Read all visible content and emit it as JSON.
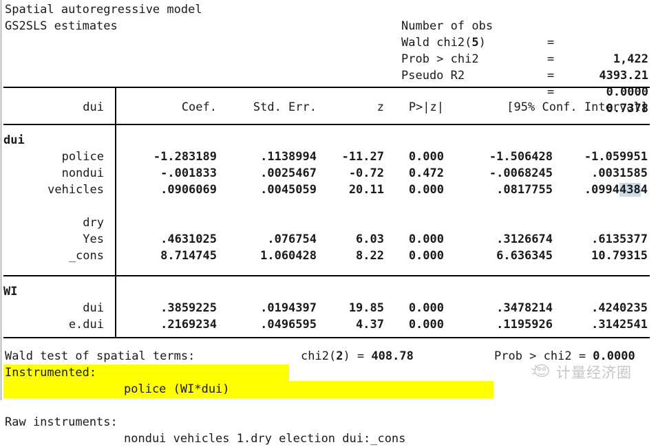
{
  "window": {
    "title_line1": "Spatial autoregressive model",
    "title_line2": "GS2SLS estimates"
  },
  "summary_stats": [
    {
      "label": "Number of obs",
      "eq": "=",
      "value": "1,422",
      "bold_paren": ""
    },
    {
      "label": "Wald chi2(",
      "eq": "=",
      "value": "4393.21",
      "bold_paren": "5",
      "label_tail": ")"
    },
    {
      "label": "Prob > chi2",
      "eq": "=",
      "value": "0.0000",
      "bold_paren": ""
    },
    {
      "label": "Pseudo R2",
      "eq": "=",
      "value": "0.7378",
      "bold_paren": ""
    }
  ],
  "table": {
    "dep_var_header": "dui",
    "columns": [
      "Coef.",
      "Std. Err.",
      "z",
      "P>|z|",
      "[95% Conf. Interval]"
    ],
    "col_coef": "Coef.",
    "col_se": "Std. Err.",
    "col_z": "z",
    "col_p": "P>|z|",
    "col_ci": "[95% Conf. Interval]",
    "blocks": [
      {
        "equation": "dui",
        "rows": [
          {
            "name": "police",
            "coef": "-1.283189",
            "se": ".1138994",
            "z": "-11.27",
            "p": "0.000",
            "ci_lo": "-1.506428",
            "ci_hi": "-1.059951"
          },
          {
            "name": "nondui",
            "coef": "-.001833",
            "se": ".0025467",
            "z": "-0.72",
            "p": "0.472",
            "ci_lo": "-.0068245",
            "ci_hi": ".0031585"
          },
          {
            "name": "vehicles",
            "coef": ".0906069",
            "se": ".0045059",
            "z": "20.11",
            "p": "0.000",
            "ci_lo": ".0817755",
            "ci_hi": ".0994384"
          },
          {
            "name": "",
            "coef": "",
            "se": "",
            "z": "",
            "p": "",
            "ci_lo": "",
            "ci_hi": ""
          },
          {
            "name": "dry",
            "coef": "",
            "se": "",
            "z": "",
            "p": "",
            "ci_lo": "",
            "ci_hi": ""
          },
          {
            "name": "Yes",
            "coef": ".4631025",
            "se": ".076754",
            "z": "6.03",
            "p": "0.000",
            "ci_lo": ".3126674",
            "ci_hi": ".6135377"
          },
          {
            "name": "_cons",
            "coef": "8.714745",
            "se": "1.060428",
            "z": "8.22",
            "p": "0.000",
            "ci_lo": "6.636345",
            "ci_hi": "10.79315"
          }
        ]
      },
      {
        "equation": "WI",
        "rows": [
          {
            "name": "dui",
            "coef": ".3859225",
            "se": ".0194397",
            "z": "19.85",
            "p": "0.000",
            "ci_lo": ".3478214",
            "ci_hi": ".4240235"
          },
          {
            "name": "e.dui",
            "coef": ".2169234",
            "se": ".0496595",
            "z": "4.37",
            "p": "0.000",
            "ci_lo": ".1195926",
            "ci_hi": ".3142541"
          }
        ]
      }
    ],
    "selection": {
      "row": "vehicles",
      "column": "ci_hi",
      "selected_text": "438",
      "prefix_text": ".0994",
      "suffix_text": "4",
      "highlight_color": "#cdd9ea"
    }
  },
  "footer": {
    "wald_test_label": "Wald test of spatial terms:",
    "wald_chi2_prefix": "chi2(",
    "wald_chi2_df": "2",
    "wald_chi2_mid": ") = ",
    "wald_chi2_value": "408.78",
    "wald_prob_label": "Prob > chi2 = ",
    "wald_prob_value": "0.0000",
    "instrumented_label": "Instrumented:",
    "instrumented_value": "police (WI*dui)",
    "raw_instruments_label": "Raw instruments:",
    "raw_instruments_value": "nondui vehicles 1.dry election dui:_cons",
    "highlight_color": "#ffff00"
  },
  "watermark": {
    "text": "计量经济圈",
    "color": "#c6c6c6"
  }
}
